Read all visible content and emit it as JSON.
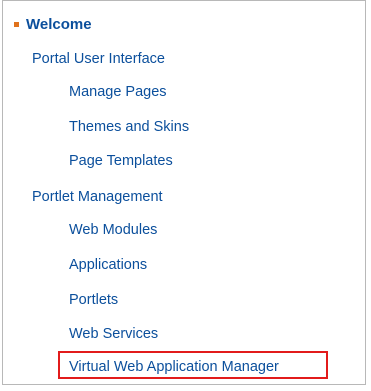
{
  "nav": {
    "welcome": "Welcome",
    "sections": [
      {
        "label": "Portal User Interface",
        "items": [
          "Manage Pages",
          "Themes and Skins",
          "Page Templates"
        ]
      },
      {
        "label": "Portlet Management",
        "items": [
          "Web Modules",
          "Applications",
          "Portlets",
          "Web Services",
          "Virtual Web Application Manager"
        ]
      }
    ]
  },
  "colors": {
    "link": "#0b4f9c",
    "bullet": "#e0721c",
    "highlight": "#e21b1b",
    "border": "#b8b8b8"
  }
}
